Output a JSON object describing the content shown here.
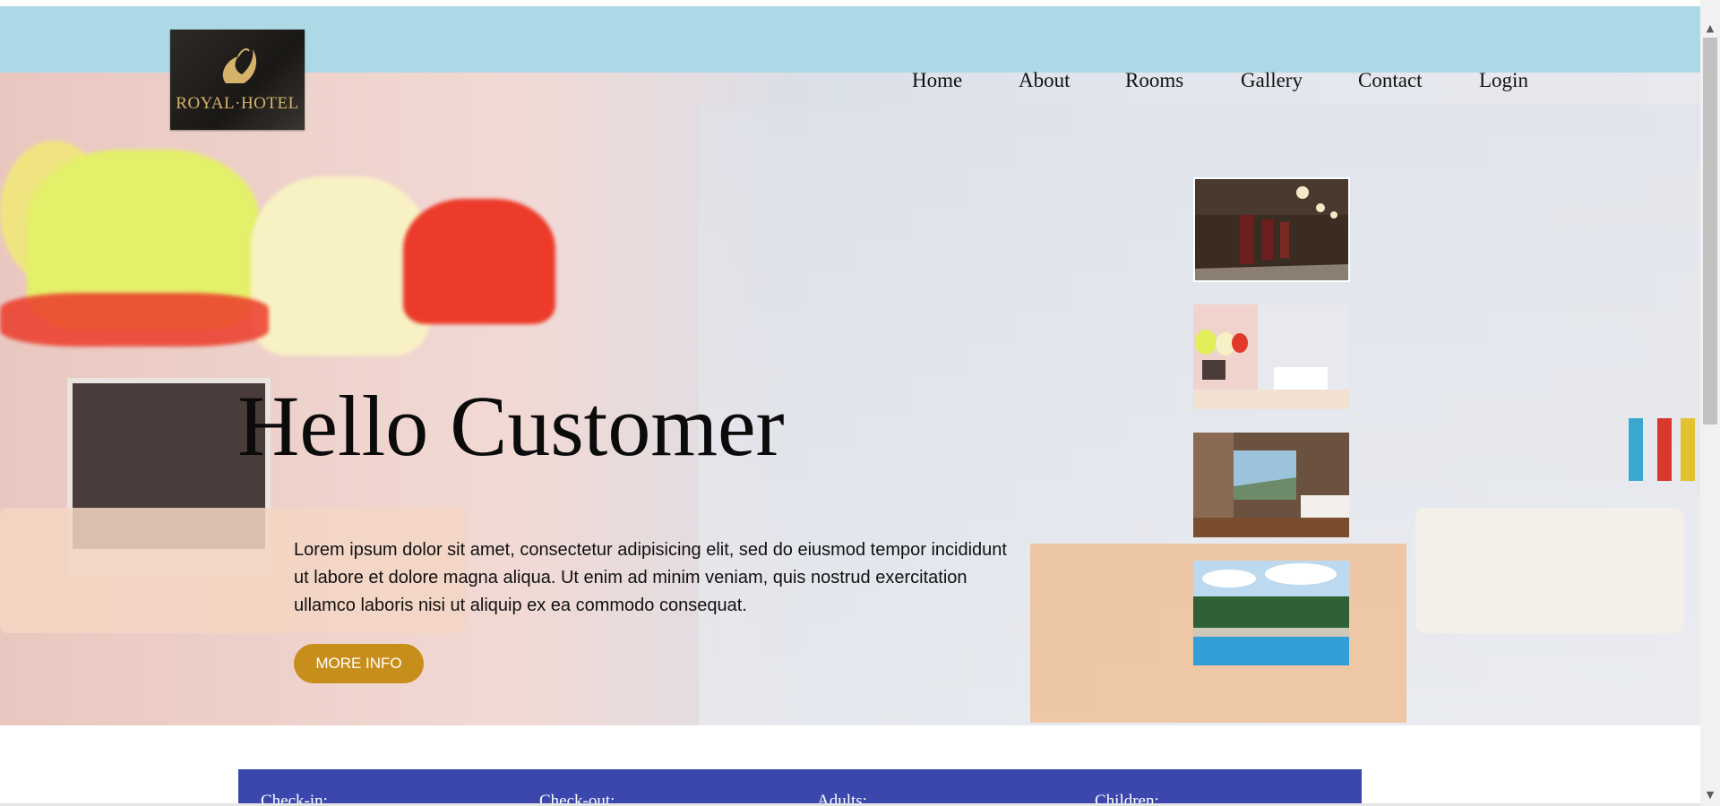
{
  "brand": {
    "logo_text": "ROYAL·HOTEL"
  },
  "nav": {
    "items": [
      "Home",
      "About",
      "Rooms",
      "Gallery",
      "Contact",
      "Login"
    ]
  },
  "hero": {
    "title": "Hello Customer",
    "text": "Lorem ipsum dolor sit amet, consectetur adipisicing elit, sed do eiusmod tempor incididunt ut labore et dolore magna aliqua. Ut enim ad minim veniam, quis nostrud exercitation ullamco laboris nisi ut aliquip ex ea commodo consequat.",
    "button_label": "MORE INFO"
  },
  "gallery": {
    "thumbnails": [
      "hotel-corridor",
      "hotel-lobby",
      "hotel-room",
      "hotel-pool"
    ]
  },
  "booking": {
    "fields": [
      "Check-in:",
      "Check-out:",
      "Adults:",
      "Children:"
    ]
  },
  "colors": {
    "header_bar": "#add8e6",
    "button": "#c88e1b",
    "booking_bar": "#3b47ac",
    "logo_gold": "#d5b36a"
  }
}
